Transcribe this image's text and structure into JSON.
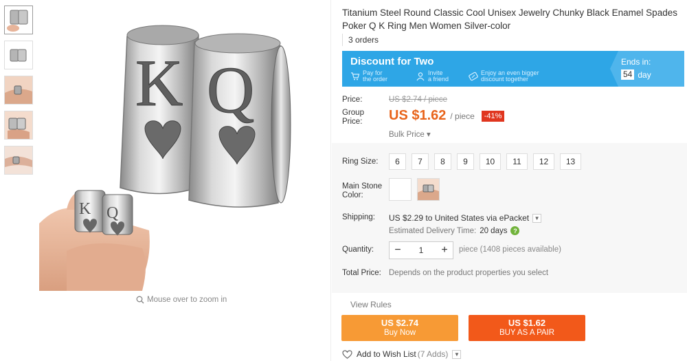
{
  "product": {
    "title": "Titanium Steel Round Classic Cool Unisex Jewelry Chunky Black Enamel Spades Poker Q K Ring Men Women Silver-color",
    "orders": "3 orders"
  },
  "gallery": {
    "zoom_hint": "Mouse over to zoom in",
    "ring_letters": [
      "K",
      "Q"
    ]
  },
  "discount": {
    "title": "Discount for Two",
    "features": [
      {
        "line1": "Pay for",
        "line2": "the order",
        "icon": "cart-icon"
      },
      {
        "line1": "Invite",
        "line2": "a friend",
        "icon": "person-icon"
      },
      {
        "line1": "Enjoy an even bigger",
        "line2": "discount together",
        "icon": "coupon-icon"
      }
    ],
    "ends_label": "Ends in:",
    "ends_value": "54",
    "ends_unit": "day"
  },
  "pricing": {
    "price_label": "Price:",
    "old_price": "US $2.74 / piece",
    "group_label_1": "Group",
    "group_label_2": "Price:",
    "group_price": "US $1.62",
    "unit": "/ piece",
    "discount_badge": "-41%",
    "bulk_price": "Bulk Price ▾"
  },
  "options": {
    "ring_size_label": "Ring Size:",
    "sizes": [
      "6",
      "7",
      "8",
      "9",
      "10",
      "11",
      "12",
      "13"
    ],
    "main_stone_label_1": "Main Stone",
    "main_stone_label_2": "Color:"
  },
  "shipping": {
    "label": "Shipping:",
    "text": "US $2.29 to United States via ePacket",
    "delivery_label": "Estimated Delivery Time:",
    "delivery_value": "20 days",
    "help": "?"
  },
  "quantity": {
    "label": "Quantity:",
    "minus": "−",
    "value": "1",
    "plus": "+",
    "availability": "piece (1408 pieces available)"
  },
  "total": {
    "label": "Total Price:",
    "note": "Depends on the product properties you select"
  },
  "actions": {
    "view_rules": "View Rules",
    "buy_now_price": "US $2.74",
    "buy_now_label": "Buy Now",
    "buy_pair_price": "US $1.62",
    "buy_pair_label": "BUY AS A PAIR"
  },
  "wishlist": {
    "label": "Add to Wish List",
    "count": "(7 Adds)"
  },
  "colors": {
    "banner": "#2ea6e6",
    "price_orange": "#e8641b",
    "badge_red": "#e0361f",
    "buy_now": "#f79a35",
    "buy_pair": "#f2591a"
  }
}
